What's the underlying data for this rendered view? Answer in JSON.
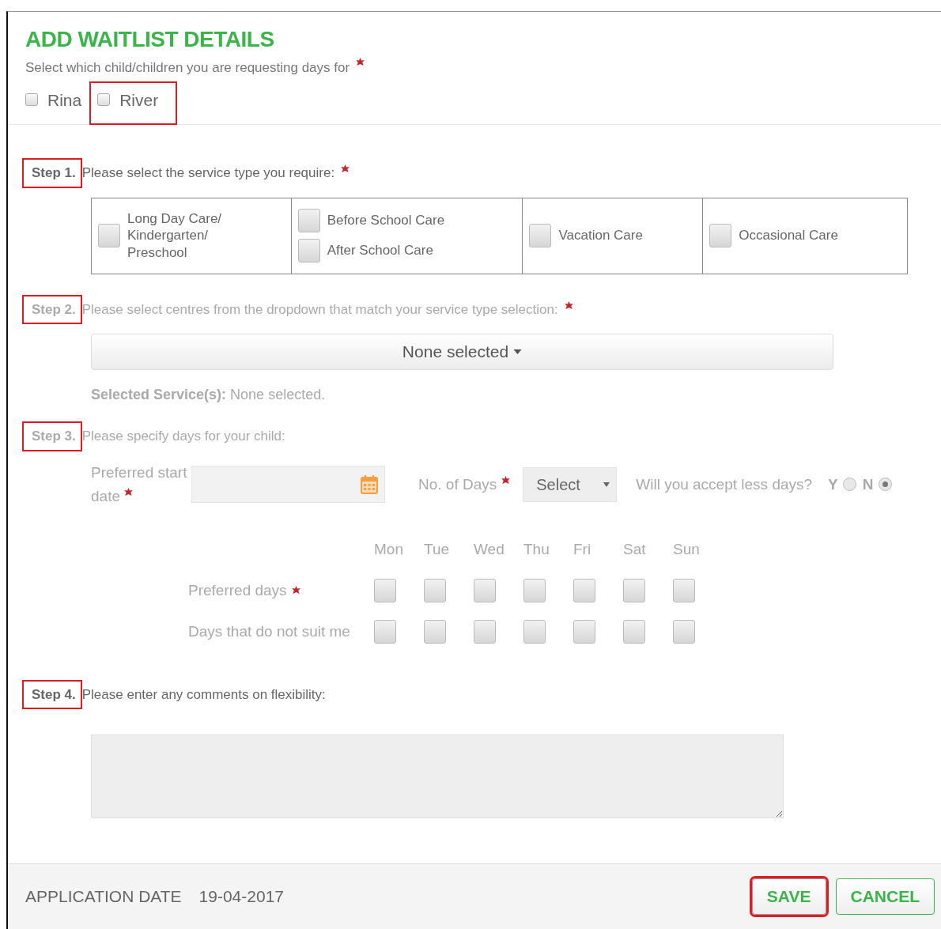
{
  "title": "ADD WAITLIST DETAILS",
  "child_prompt": {
    "text": "Select which child/children you are requesting days for",
    "required": true
  },
  "children": [
    {
      "name": "Rina",
      "checked": false,
      "highlighted": false
    },
    {
      "name": "River",
      "checked": false,
      "highlighted": true
    }
  ],
  "steps": [
    {
      "kind": "service_types",
      "label": "Step 1.",
      "text": "Please select the service type you require:",
      "required": true,
      "disabled": false,
      "highlighted": true,
      "service_groups": [
        [
          {
            "label": "Long Day Care/ Kindergarten/ Preschool",
            "checked": false
          }
        ],
        [
          {
            "label": "Before School Care",
            "checked": false
          },
          {
            "label": "After School Care",
            "checked": false
          }
        ],
        [
          {
            "label": "Vacation Care",
            "checked": false
          }
        ],
        [
          {
            "label": "Occasional Care",
            "checked": false
          }
        ]
      ]
    },
    {
      "kind": "centres",
      "label": "Step 2.",
      "text": "Please select centres from the dropdown that match your service type selection:",
      "required": true,
      "disabled": true,
      "highlighted": true,
      "dropdown": "None selected",
      "summary": "**Selected Service(s):** None selected."
    },
    {
      "kind": "days",
      "label": "Step 3.",
      "text": "Please specify days for your child:",
      "required": false,
      "disabled": true,
      "highlighted": true,
      "start_date": {
        "label": "Preferred start date",
        "required": true
      },
      "days_count": {
        "label": "No. of Days",
        "required": true,
        "value": "Select"
      },
      "accept_less": {
        "question": "Will you accept less days?",
        "options": [
          {
            "label": "Y",
            "selected": false
          },
          {
            "label": "N",
            "selected": true
          }
        ]
      },
      "weekdays": [
        "Mon",
        "Tue",
        "Wed",
        "Thu",
        "Fri",
        "Sat",
        "Sun"
      ],
      "day_rows": [
        {
          "label": "Preferred days",
          "required": true,
          "days": [
            false,
            false,
            false,
            false,
            false,
            false,
            false
          ]
        },
        {
          "label": "Days that do not suit me",
          "required": false,
          "days": [
            false,
            false,
            false,
            false,
            false,
            false,
            false
          ]
        }
      ]
    },
    {
      "kind": "comments",
      "label": "Step 4.",
      "text": "Please enter any comments on flexibility:",
      "required": false,
      "disabled": false,
      "highlighted": true
    }
  ],
  "footer": {
    "label": "APPLICATION DATE",
    "date": "19-04-2017",
    "buttons": [
      {
        "label": "SAVE",
        "highlighted": true
      },
      {
        "label": "CANCEL",
        "highlighted": false
      }
    ]
  }
}
